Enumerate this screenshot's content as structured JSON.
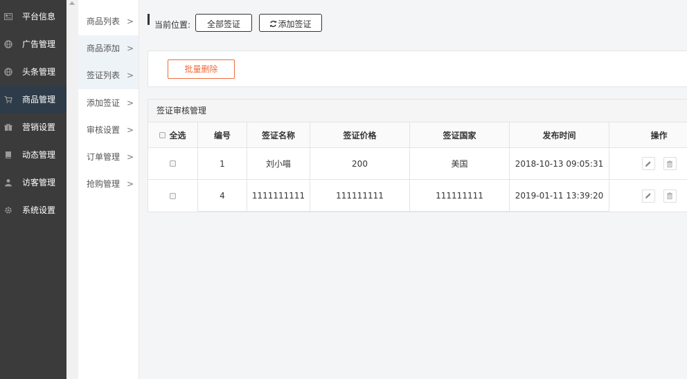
{
  "sidebar": {
    "items": [
      {
        "label": "平台信息",
        "icon": "newspaper-icon"
      },
      {
        "label": "广告管理",
        "icon": "globe-icon"
      },
      {
        "label": "头条管理",
        "icon": "globe-icon"
      },
      {
        "label": "商品管理",
        "icon": "cart-icon",
        "active": true
      },
      {
        "label": "营销设置",
        "icon": "gift-icon"
      },
      {
        "label": "动态管理",
        "icon": "book-icon"
      },
      {
        "label": "访客管理",
        "icon": "user-icon"
      },
      {
        "label": "系统设置",
        "icon": "gear-icon"
      }
    ]
  },
  "submenu": {
    "items": [
      {
        "label": "商品列表"
      },
      {
        "label": "商品添加"
      },
      {
        "label": "签证列表"
      },
      {
        "label": "添加签证"
      },
      {
        "label": "审核设置"
      },
      {
        "label": "订单管理"
      },
      {
        "label": "抢购管理"
      }
    ],
    "chevron": ">"
  },
  "breadcrumb": {
    "label": "当前位置:",
    "all_button": "全部签证",
    "add_button": "添加签证"
  },
  "toolbar": {
    "batch_delete": "批量删除"
  },
  "table": {
    "title": "签证审核管理",
    "select_all": "全选",
    "columns": [
      "编号",
      "签证名称",
      "签证价格",
      "签证国家",
      "发布时间",
      "操作"
    ],
    "rows": [
      {
        "id": "1",
        "name": "刘小喵",
        "price": "200",
        "country": "美国",
        "time": "2018-10-13 09:05:31"
      },
      {
        "id": "4",
        "name": "1111111111",
        "price": "111111111",
        "country": "111111111",
        "time": "2019-01-11 13:39:20"
      }
    ]
  },
  "colors": {
    "sidebar_bg": "#3b3b3b",
    "sidebar_active": "#2e3b48",
    "accent_orange": "#f06a3a"
  }
}
